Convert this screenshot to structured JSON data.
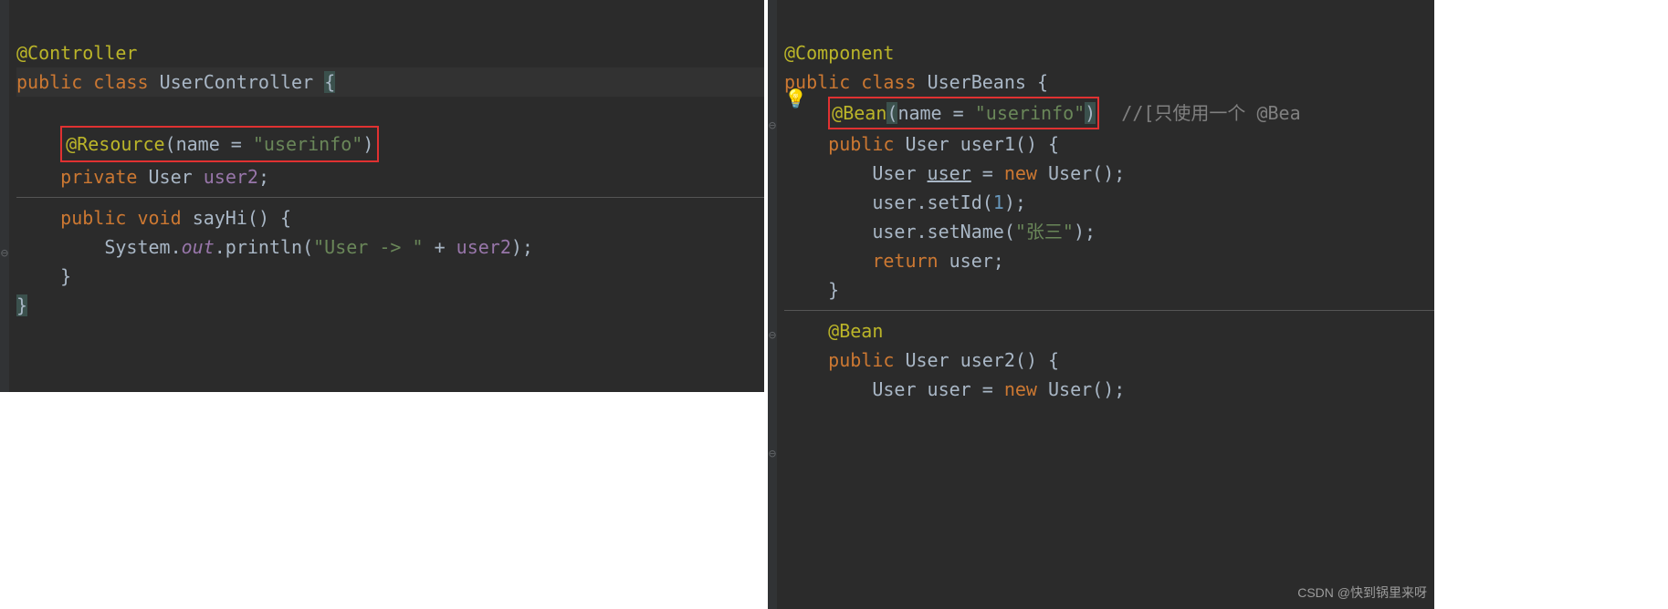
{
  "left": {
    "l1": {
      "ann": "@Controller"
    },
    "l2": {
      "kw1": "public",
      "kw2": "class",
      "cls": "UserController",
      "brace": "{"
    },
    "l4box": {
      "ann": "@Resource",
      "open": "(",
      "name": "name = ",
      "str": "\"userinfo\"",
      "close": ")"
    },
    "l5": {
      "kw": "private",
      "type": "User",
      "field": "user2",
      "semi": ";"
    },
    "l7": {
      "kw1": "public",
      "kw2": "void",
      "method": "sayHi",
      "parens": "()",
      "brace": "{"
    },
    "l8": {
      "sys": "System.",
      "out": "out",
      "println": ".println(",
      "str": "\"User -> \"",
      "plus": " + ",
      "field": "user2",
      "close": ");"
    },
    "l9": {
      "brace": "}"
    },
    "l10": {
      "brace": "}"
    }
  },
  "right": {
    "l1": {
      "ann": "@Component"
    },
    "l2": {
      "kw1": "public",
      "kw2": "class",
      "cls": "UserBeans",
      "brace": "{"
    },
    "l3": {
      "ann": "@Bean",
      "open": "(",
      "name": "name = ",
      "str": "\"userinfo\"",
      "close": ")",
      "comment": "//[只使用一个 @Bea"
    },
    "l4": {
      "kw": "public",
      "type": "User",
      "method": "user1",
      "parens": "()",
      "brace": "{"
    },
    "l5": {
      "type": "User",
      "var": "user",
      "eq": " = ",
      "kw": "new",
      "ctor": "User()",
      "semi": ";"
    },
    "l6": {
      "obj": "user",
      "call": ".setId(",
      "num": "1",
      "close": ");"
    },
    "l7": {
      "obj": "user",
      "call": ".setName(",
      "str": "\"张三\"",
      "close": ");"
    },
    "l8": {
      "kw": "return",
      "var": "user",
      "semi": ";"
    },
    "l9": {
      "brace": "}"
    },
    "l11": {
      "ann": "@Bean"
    },
    "l12": {
      "kw": "public",
      "type": "User",
      "method": "user2",
      "parens": "()",
      "brace": "{"
    },
    "l13": {
      "type": "User",
      "var": "user",
      "eq": " = ",
      "kw": "new",
      "ctor": "User()",
      "semi": ";"
    }
  },
  "watermark": "CSDN @快到锅里来呀"
}
